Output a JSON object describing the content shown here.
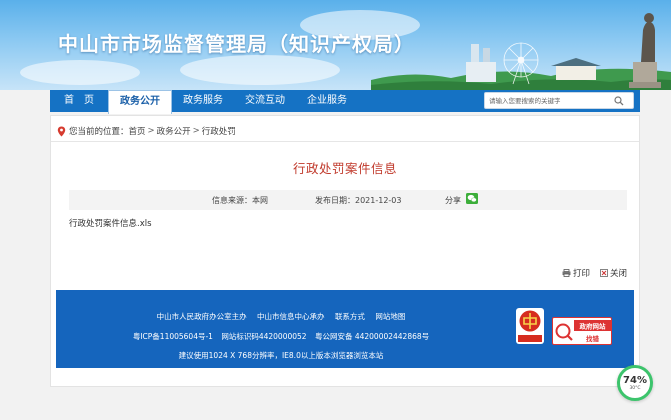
{
  "site": {
    "title": "中山市市场监督管理局（知识产权局）"
  },
  "nav": {
    "items": [
      {
        "label": "首　页",
        "active": false
      },
      {
        "label": "政务公开",
        "active": true
      },
      {
        "label": "政务服务",
        "active": false
      },
      {
        "label": "交流互动",
        "active": false
      },
      {
        "label": "企业服务",
        "active": false
      }
    ],
    "search_placeholder": "请输入您要搜索的关键字"
  },
  "breadcrumb": {
    "prefix": "您当前的位置：",
    "items": [
      "首页",
      "政务公开",
      "行政处罚"
    ],
    "separator": ">"
  },
  "article": {
    "title": "行政处罚案件信息",
    "source_label": "信息来源：本网",
    "date_label": "发布日期：2021-12-03",
    "share_label": "分享",
    "attachment": "行政处罚案件信息.xls"
  },
  "tools": {
    "print": "打印",
    "close": "关闭"
  },
  "footer": {
    "links": [
      "中山市人民政府办公室主办",
      "中山市信息中心承办",
      "联系方式",
      "网站地图"
    ],
    "icp": "粤ICP备11005604号-1",
    "site_code": "网站标识码4420000052",
    "police": "粤公网安备 44200002442868号",
    "browser_note": "建议使用1024 X 768分辨率，IE8.0以上版本浏览器浏览本站",
    "badge_red_text": "党政机关",
    "badge_gov_line1": "政府网站",
    "badge_gov_line2": "找错"
  },
  "widget": {
    "percent": "74%",
    "temp": "30°C"
  },
  "colors": {
    "nav": "#1572c4",
    "footer": "#1565bd",
    "title_red": "#c0392b"
  }
}
